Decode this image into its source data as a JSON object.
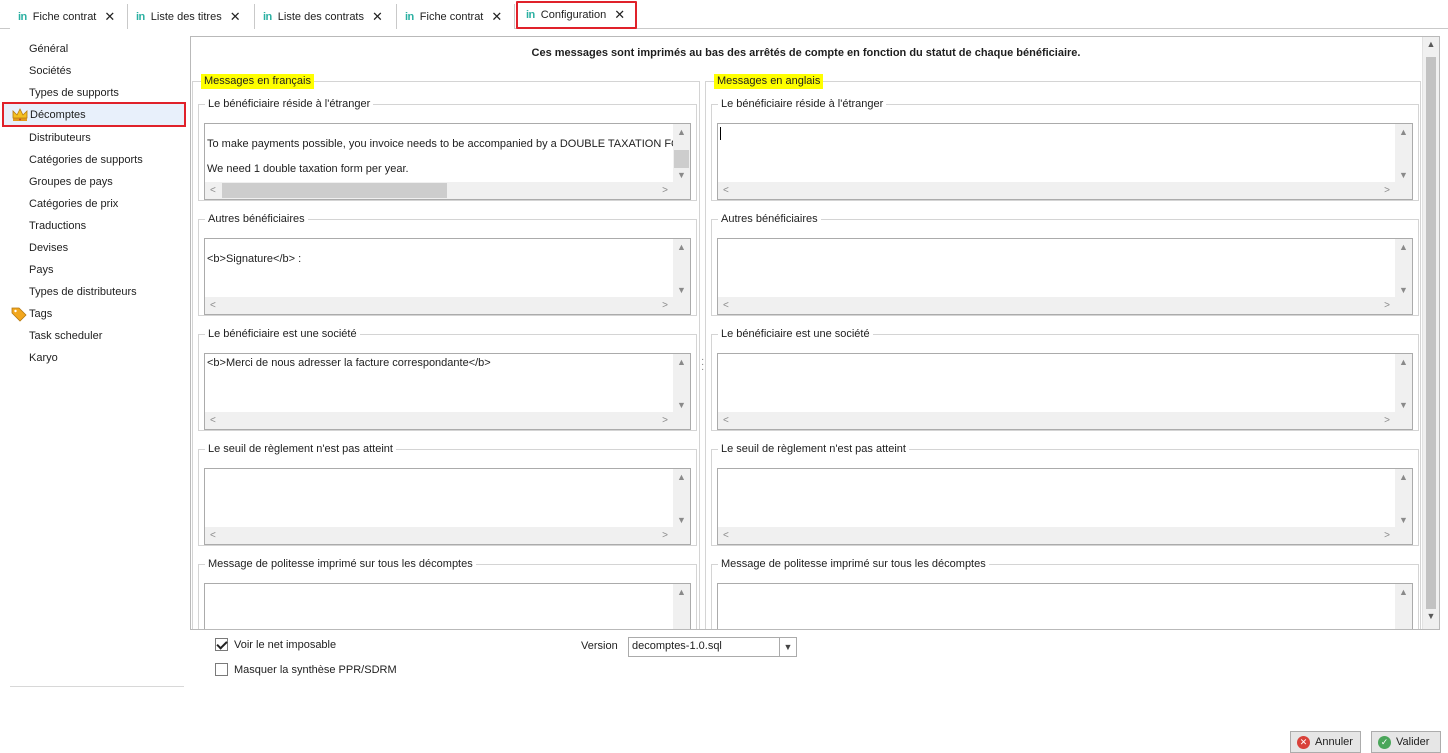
{
  "tabs": [
    {
      "logo": "in",
      "label": "Fiche contrat",
      "close": "✕"
    },
    {
      "logo": "in",
      "label": "Liste des titres",
      "close": "✕"
    },
    {
      "logo": "in",
      "label": "Liste des contrats",
      "close": "✕"
    },
    {
      "logo": "in",
      "label": "Fiche contrat",
      "close": "✕"
    },
    {
      "logo": "in",
      "label": "Configuration",
      "close": "✕",
      "active": true
    }
  ],
  "sidebar": {
    "items": [
      {
        "label": "Général"
      },
      {
        "label": "Sociétés"
      },
      {
        "label": "Types de supports"
      },
      {
        "label": "Décomptes",
        "icon": "crown-icon",
        "selected": true
      },
      {
        "label": "Distributeurs"
      },
      {
        "label": "Catégories de supports"
      },
      {
        "label": "Groupes de pays"
      },
      {
        "label": "Catégories de prix"
      },
      {
        "label": "Traductions"
      },
      {
        "label": "Devises"
      },
      {
        "label": "Pays"
      },
      {
        "label": "Types de distributeurs"
      },
      {
        "label": "Tags",
        "icon": "tag-icon"
      },
      {
        "label": "Task scheduler"
      },
      {
        "label": "Karyo"
      }
    ]
  },
  "main": {
    "title": "Ces messages sont imprimés au bas des arrêtés de compte en fonction du statut de chaque bénéficiaire.",
    "french": {
      "legend": "Messages en français",
      "groups": [
        {
          "legend": "Le bénéficiaire réside à l'étranger",
          "lines": [
            "To make payments possible, you invoice needs to be accompanied by a DOUBLE TAXATION FORM i",
            "We need 1 double taxation form per year."
          ]
        },
        {
          "legend": "Autres bénéficiaires",
          "lines": [
            "<b>Signature</b> :"
          ]
        },
        {
          "legend": "Le bénéficiaire est une société",
          "lines": [
            "<b>Merci de nous adresser la facture correspondante</b>"
          ]
        },
        {
          "legend": "Le seuil de règlement n'est pas atteint",
          "lines": []
        },
        {
          "legend": "Message de politesse imprimé sur tous les décomptes",
          "lines": []
        }
      ]
    },
    "english": {
      "legend": "Messages en anglais",
      "groups": [
        {
          "legend": "Le bénéficiaire réside à l'étranger",
          "lines": []
        },
        {
          "legend": "Autres bénéficiaires",
          "lines": []
        },
        {
          "legend": "Le bénéficiaire est une société",
          "lines": []
        },
        {
          "legend": "Le seuil de règlement n'est pas atteint",
          "lines": []
        },
        {
          "legend": "Message de politesse imprimé sur tous les décomptes",
          "lines": []
        }
      ]
    }
  },
  "options": {
    "show_net_taxable": {
      "label": "Voir le net imposable",
      "checked": true
    },
    "hide_ppr": {
      "label": "Masquer la synthèse PPR/SDRM",
      "checked": false
    }
  },
  "version": {
    "label": "Version",
    "value": "decomptes-1.0.sql"
  },
  "buttons": {
    "cancel": "Annuler",
    "validate": "Valider"
  },
  "colors": {
    "accent_red": "#e0212a",
    "highlight_yellow": "#ffff00",
    "brand_teal": "#2bb0a2"
  }
}
